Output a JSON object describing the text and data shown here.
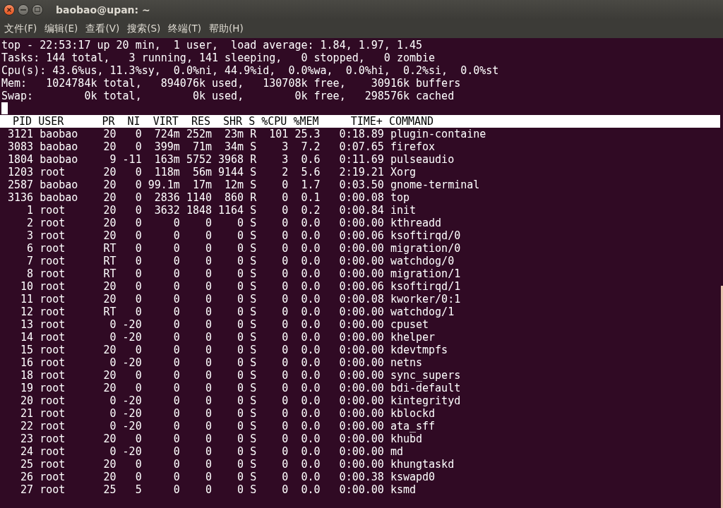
{
  "window": {
    "title": "baobao@upan: ~"
  },
  "menu": [
    "文件(F)",
    "编辑(E)",
    "查看(V)",
    "搜索(S)",
    "终端(T)",
    "帮助(H)"
  ],
  "summary": [
    "top - 22:53:17 up 20 min,  1 user,  load average: 1.84, 1.97, 1.45",
    "Tasks: 144 total,   3 running, 141 sleeping,   0 stopped,   0 zombie",
    "Cpu(s): 43.6%us, 11.3%sy,  0.0%ni, 44.9%id,  0.0%wa,  0.0%hi,  0.2%si,  0.0%st",
    "Mem:   1024784k total,   894076k used,   130708k free,    30916k buffers",
    "Swap:        0k total,        0k used,        0k free,   298576k cached"
  ],
  "table": {
    "columns": [
      "PID",
      "USER",
      "PR",
      "NI",
      "VIRT",
      "RES",
      "SHR",
      "S",
      "%CPU",
      "%MEM",
      "TIME+",
      "COMMAND"
    ],
    "rows": [
      {
        "cells": [
          "3121",
          "baobao",
          "20",
          "0",
          "724m",
          "252m",
          "23m",
          "R",
          "101",
          "25.3",
          "0:18.89",
          "plugin-containe"
        ]
      },
      {
        "cells": [
          "3083",
          "baobao",
          "20",
          "0",
          "399m",
          "71m",
          "34m",
          "S",
          "3",
          "7.2",
          "0:07.65",
          "firefox"
        ]
      },
      {
        "cells": [
          "1804",
          "baobao",
          "9",
          "-11",
          "163m",
          "5752",
          "3968",
          "R",
          "3",
          "0.6",
          "0:11.69",
          "pulseaudio"
        ]
      },
      {
        "cells": [
          "1203",
          "root",
          "20",
          "0",
          "118m",
          "56m",
          "9144",
          "S",
          "2",
          "5.6",
          "2:19.21",
          "Xorg"
        ]
      },
      {
        "cells": [
          "2587",
          "baobao",
          "20",
          "0",
          "99.1m",
          "17m",
          "12m",
          "S",
          "0",
          "1.7",
          "0:03.50",
          "gnome-terminal"
        ]
      },
      {
        "cells": [
          "3136",
          "baobao",
          "20",
          "0",
          "2836",
          "1140",
          "860",
          "R",
          "0",
          "0.1",
          "0:00.08",
          "top"
        ]
      },
      {
        "cells": [
          "1",
          "root",
          "20",
          "0",
          "3632",
          "1848",
          "1164",
          "S",
          "0",
          "0.2",
          "0:00.84",
          "init"
        ]
      },
      {
        "cells": [
          "2",
          "root",
          "20",
          "0",
          "0",
          "0",
          "0",
          "S",
          "0",
          "0.0",
          "0:00.00",
          "kthreadd"
        ]
      },
      {
        "cells": [
          "3",
          "root",
          "20",
          "0",
          "0",
          "0",
          "0",
          "S",
          "0",
          "0.0",
          "0:00.06",
          "ksoftirqd/0"
        ]
      },
      {
        "cells": [
          "6",
          "root",
          "RT",
          "0",
          "0",
          "0",
          "0",
          "S",
          "0",
          "0.0",
          "0:00.00",
          "migration/0"
        ]
      },
      {
        "cells": [
          "7",
          "root",
          "RT",
          "0",
          "0",
          "0",
          "0",
          "S",
          "0",
          "0.0",
          "0:00.00",
          "watchdog/0"
        ]
      },
      {
        "cells": [
          "8",
          "root",
          "RT",
          "0",
          "0",
          "0",
          "0",
          "S",
          "0",
          "0.0",
          "0:00.00",
          "migration/1"
        ]
      },
      {
        "cells": [
          "10",
          "root",
          "20",
          "0",
          "0",
          "0",
          "0",
          "S",
          "0",
          "0.0",
          "0:00.06",
          "ksoftirqd/1"
        ]
      },
      {
        "cells": [
          "11",
          "root",
          "20",
          "0",
          "0",
          "0",
          "0",
          "S",
          "0",
          "0.0",
          "0:00.08",
          "kworker/0:1"
        ]
      },
      {
        "cells": [
          "12",
          "root",
          "RT",
          "0",
          "0",
          "0",
          "0",
          "S",
          "0",
          "0.0",
          "0:00.00",
          "watchdog/1"
        ]
      },
      {
        "cells": [
          "13",
          "root",
          "0",
          "-20",
          "0",
          "0",
          "0",
          "S",
          "0",
          "0.0",
          "0:00.00",
          "cpuset"
        ]
      },
      {
        "cells": [
          "14",
          "root",
          "0",
          "-20",
          "0",
          "0",
          "0",
          "S",
          "0",
          "0.0",
          "0:00.00",
          "khelper"
        ]
      },
      {
        "cells": [
          "15",
          "root",
          "20",
          "0",
          "0",
          "0",
          "0",
          "S",
          "0",
          "0.0",
          "0:00.00",
          "kdevtmpfs"
        ]
      },
      {
        "cells": [
          "16",
          "root",
          "0",
          "-20",
          "0",
          "0",
          "0",
          "S",
          "0",
          "0.0",
          "0:00.00",
          "netns"
        ]
      },
      {
        "cells": [
          "18",
          "root",
          "20",
          "0",
          "0",
          "0",
          "0",
          "S",
          "0",
          "0.0",
          "0:00.00",
          "sync_supers"
        ]
      },
      {
        "cells": [
          "19",
          "root",
          "20",
          "0",
          "0",
          "0",
          "0",
          "S",
          "0",
          "0.0",
          "0:00.00",
          "bdi-default"
        ]
      },
      {
        "cells": [
          "20",
          "root",
          "0",
          "-20",
          "0",
          "0",
          "0",
          "S",
          "0",
          "0.0",
          "0:00.00",
          "kintegrityd"
        ]
      },
      {
        "cells": [
          "21",
          "root",
          "0",
          "-20",
          "0",
          "0",
          "0",
          "S",
          "0",
          "0.0",
          "0:00.00",
          "kblockd"
        ]
      },
      {
        "cells": [
          "22",
          "root",
          "0",
          "-20",
          "0",
          "0",
          "0",
          "S",
          "0",
          "0.0",
          "0:00.00",
          "ata_sff"
        ]
      },
      {
        "cells": [
          "23",
          "root",
          "20",
          "0",
          "0",
          "0",
          "0",
          "S",
          "0",
          "0.0",
          "0:00.00",
          "khubd"
        ]
      },
      {
        "cells": [
          "24",
          "root",
          "0",
          "-20",
          "0",
          "0",
          "0",
          "S",
          "0",
          "0.0",
          "0:00.00",
          "md"
        ]
      },
      {
        "cells": [
          "25",
          "root",
          "20",
          "0",
          "0",
          "0",
          "0",
          "S",
          "0",
          "0.0",
          "0:00.00",
          "khungtaskd"
        ]
      },
      {
        "cells": [
          "26",
          "root",
          "20",
          "0",
          "0",
          "0",
          "0",
          "S",
          "0",
          "0.0",
          "0:00.38",
          "kswapd0"
        ]
      },
      {
        "cells": [
          "27",
          "root",
          "25",
          "5",
          "0",
          "0",
          "0",
          "S",
          "0",
          "0.0",
          "0:00.00",
          "ksmd"
        ]
      }
    ]
  }
}
